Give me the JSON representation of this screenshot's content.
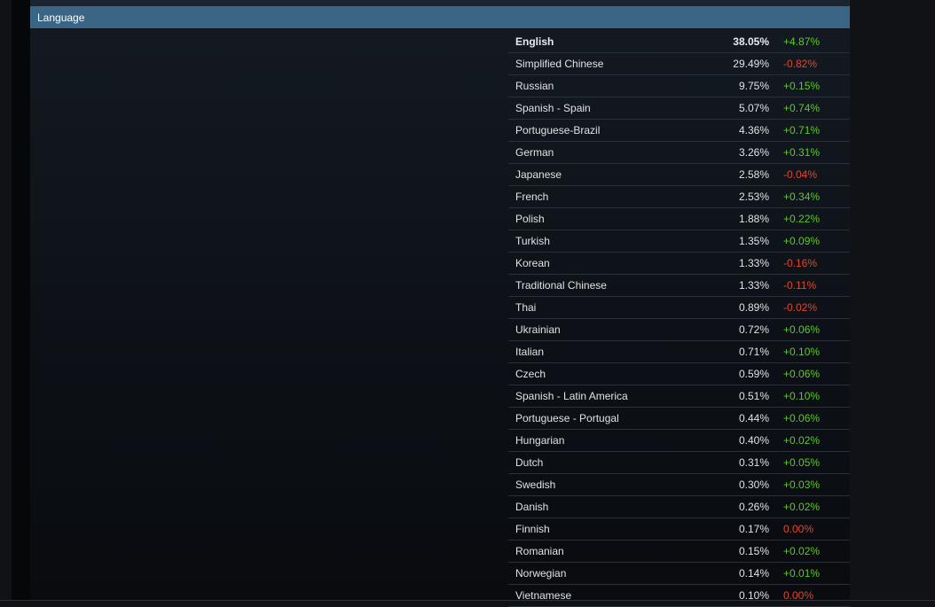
{
  "section": {
    "title": "Language"
  },
  "colors": {
    "header_bg": "#3b6584",
    "positive": "#5fc72e",
    "negative": "#e0472b",
    "text": "#dfe3e6"
  },
  "languages": [
    {
      "name": "English",
      "share": "38.05%",
      "change": "+4.87%",
      "trend": "pos"
    },
    {
      "name": "Simplified Chinese",
      "share": "29.49%",
      "change": "-0.82%",
      "trend": "neg"
    },
    {
      "name": "Russian",
      "share": "9.75%",
      "change": "+0.15%",
      "trend": "pos"
    },
    {
      "name": "Spanish - Spain",
      "share": "5.07%",
      "change": "+0.74%",
      "trend": "pos"
    },
    {
      "name": "Portuguese-Brazil",
      "share": "4.36%",
      "change": "+0.71%",
      "trend": "pos"
    },
    {
      "name": "German",
      "share": "3.26%",
      "change": "+0.31%",
      "trend": "pos"
    },
    {
      "name": "Japanese",
      "share": "2.58%",
      "change": "-0.04%",
      "trend": "neg"
    },
    {
      "name": "French",
      "share": "2.53%",
      "change": "+0.34%",
      "trend": "pos"
    },
    {
      "name": "Polish",
      "share": "1.88%",
      "change": "+0.22%",
      "trend": "pos"
    },
    {
      "name": "Turkish",
      "share": "1.35%",
      "change": "+0.09%",
      "trend": "pos"
    },
    {
      "name": "Korean",
      "share": "1.33%",
      "change": "-0.16%",
      "trend": "neg"
    },
    {
      "name": "Traditional Chinese",
      "share": "1.33%",
      "change": "-0.11%",
      "trend": "neg"
    },
    {
      "name": "Thai",
      "share": "0.89%",
      "change": "-0.02%",
      "trend": "neg"
    },
    {
      "name": "Ukrainian",
      "share": "0.72%",
      "change": "+0.06%",
      "trend": "pos"
    },
    {
      "name": "Italian",
      "share": "0.71%",
      "change": "+0.10%",
      "trend": "pos"
    },
    {
      "name": "Czech",
      "share": "0.59%",
      "change": "+0.06%",
      "trend": "pos"
    },
    {
      "name": "Spanish - Latin America",
      "share": "0.51%",
      "change": "+0.10%",
      "trend": "pos"
    },
    {
      "name": "Portuguese - Portugal",
      "share": "0.44%",
      "change": "+0.06%",
      "trend": "pos"
    },
    {
      "name": "Hungarian",
      "share": "0.40%",
      "change": "+0.02%",
      "trend": "pos"
    },
    {
      "name": "Dutch",
      "share": "0.31%",
      "change": "+0.05%",
      "trend": "pos"
    },
    {
      "name": "Swedish",
      "share": "0.30%",
      "change": "+0.03%",
      "trend": "pos"
    },
    {
      "name": "Danish",
      "share": "0.26%",
      "change": "+0.02%",
      "trend": "pos"
    },
    {
      "name": "Finnish",
      "share": "0.17%",
      "change": "0.00%",
      "trend": "neg"
    },
    {
      "name": "Romanian",
      "share": "0.15%",
      "change": "+0.02%",
      "trend": "pos"
    },
    {
      "name": "Norwegian",
      "share": "0.14%",
      "change": "+0.01%",
      "trend": "pos"
    },
    {
      "name": "Vietnamese",
      "share": "0.10%",
      "change": "0.00%",
      "trend": "neg"
    }
  ]
}
